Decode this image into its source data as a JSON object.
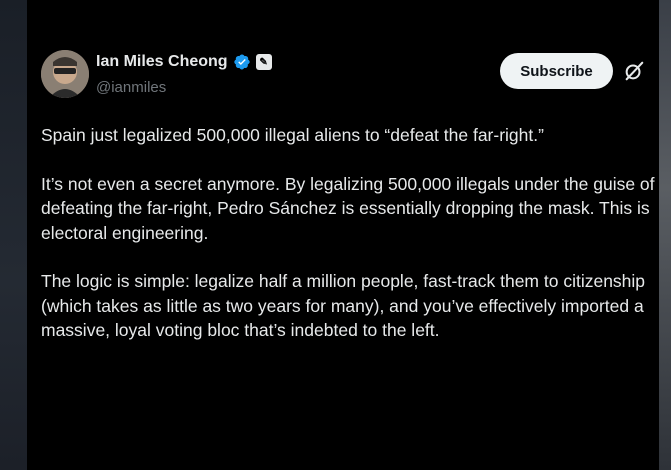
{
  "author": {
    "name": "Ian Miles Cheong",
    "handle": "@ianmiles",
    "verified": true,
    "affiliation_badge_glyph": "✎"
  },
  "actions": {
    "subscribe_label": "Subscribe"
  },
  "icons": {
    "verified": "verified-badge-icon",
    "grok": "grok-icon",
    "affiliation": "affiliation-badge-icon"
  },
  "colors": {
    "background": "#000000",
    "text": "#e7e9ea",
    "secondary_text": "#71767b",
    "verified_blue": "#1d9bf0",
    "subscribe_bg": "#eff3f4"
  },
  "tweet": {
    "paragraphs": [
      "Spain just legalized 500,000 illegal aliens to “defeat the far-right.”",
      "It’s not even a secret anymore. By legalizing 500,000 illegals under the guise of defeating the far-right, Pedro Sánchez is essentially dropping the mask. This is electoral engineering.",
      "The logic is simple: legalize half a million people, fast-track them to citizenship (which takes as little as two years for many), and you’ve effectively imported a massive, loyal voting bloc that’s indebted to the left."
    ]
  }
}
